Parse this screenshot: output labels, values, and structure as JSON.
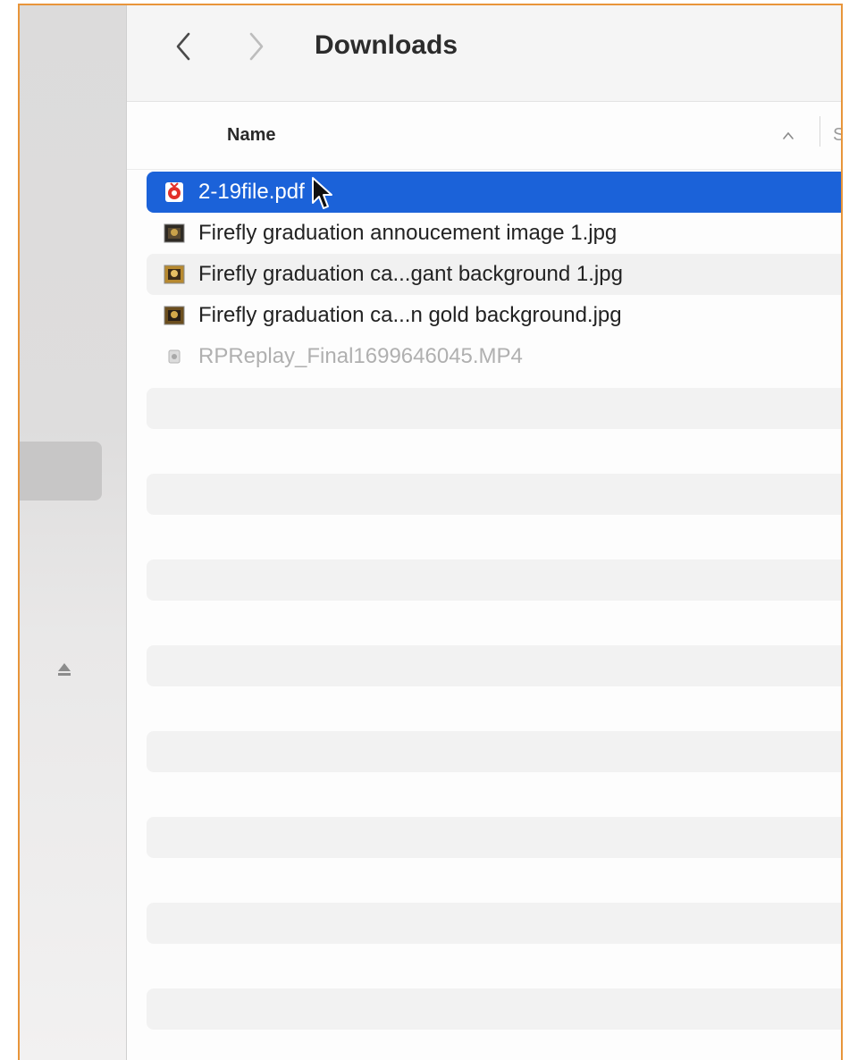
{
  "window": {
    "title": "Downloads"
  },
  "toolbar": {
    "back_icon": "chevron-left-icon",
    "forward_icon": "chevron-right-icon"
  },
  "header": {
    "name_label": "Name",
    "size_label_partial": "S"
  },
  "files": [
    {
      "name": "2-19file.pdf",
      "icon": "pdf-icon",
      "selected": true
    },
    {
      "name": "Firefly graduation annoucement image 1.jpg",
      "icon": "image-icon",
      "selected": false
    },
    {
      "name": "Firefly graduation ca...gant background 1.jpg",
      "icon": "image-icon",
      "selected": false
    },
    {
      "name": "Firefly graduation ca...n gold background.jpg",
      "icon": "image-icon",
      "selected": false
    },
    {
      "name": "RPReplay_Final1699646045.MP4",
      "icon": "video-icon",
      "selected": false,
      "dimmed": true
    }
  ],
  "colors": {
    "selection": "#1b62d9",
    "frame_border": "#e8953a"
  }
}
